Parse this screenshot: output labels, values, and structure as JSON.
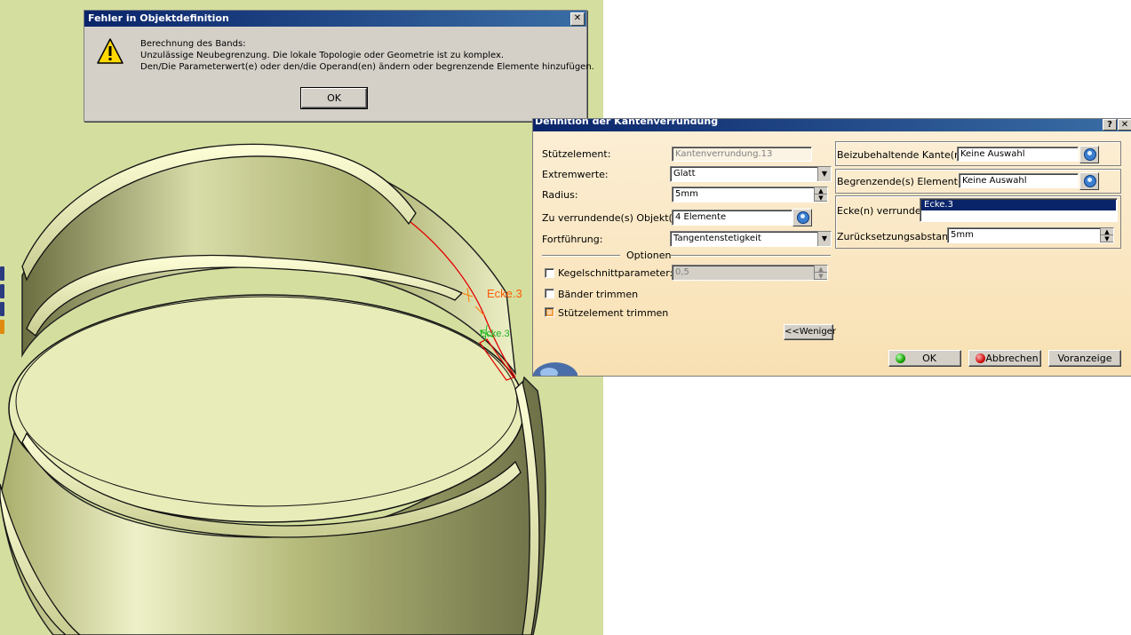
{
  "viewport": {
    "labels": {
      "corner_main": "Ecke.3",
      "corner_secondary": "Ecke.3"
    }
  },
  "error_dialog": {
    "title": "Fehler in Objektdefinition",
    "close_glyph": "✕",
    "icon": "warning-icon",
    "lines": [
      "Berechnung des Bands:",
      "Unzulässige Neubegrenzung. Die lokale Topologie oder Geometrie ist zu komplex.",
      "Den/Die Parameterwert(e) oder den/die Operand(en) ändern oder begrenzende Elemente hinzufügen."
    ],
    "ok_label": "OK"
  },
  "fillet_dialog": {
    "title": "Definition der Kantenverrundung",
    "help_glyph": "?",
    "close_glyph": "✕",
    "support": {
      "label": "Stützelement:",
      "value": "Kantenverrundung.13"
    },
    "extremities": {
      "label": "Extremwerte:",
      "value": "Glatt"
    },
    "radius": {
      "label": "Radius:",
      "value": "5mm"
    },
    "objects": {
      "label": "Zu verrundende(s) Objekt(e):",
      "value": "4 Elemente"
    },
    "propagation": {
      "label": "Fortführung:",
      "value": "Tangentenstetigkeit"
    },
    "options_heading": "Optionen",
    "conic": {
      "label": "Kegelschnittparameter:",
      "value": "0,5",
      "checked": false
    },
    "trim_ribbons": {
      "label": "Bänder trimmen",
      "checked": false
    },
    "trim_support": {
      "label": "Stützelement trimmen",
      "checked": true
    },
    "less_button": "<<Weniger",
    "edges_to_keep": {
      "label": "Beizubehaltende Kante(n):",
      "value": "Keine Auswahl"
    },
    "limiting": {
      "label": "Begrenzende(s) Element(e):",
      "value": "Keine Auswahl"
    },
    "corners": {
      "label": "Ecke(n) verrunden",
      "items": [
        "Ecke.3"
      ]
    },
    "setback": {
      "label": "Zurücksetzungsabstand:",
      "value": "5mm"
    },
    "buttons": {
      "ok": "OK",
      "cancel": "Abbrechen",
      "preview": "Voranzeige"
    }
  },
  "colors": {
    "viewport_bg": "#d4df9f",
    "titlebar": "#0a246a",
    "dialog_bg": "#fbe8c4",
    "selection": "#0a246a"
  }
}
